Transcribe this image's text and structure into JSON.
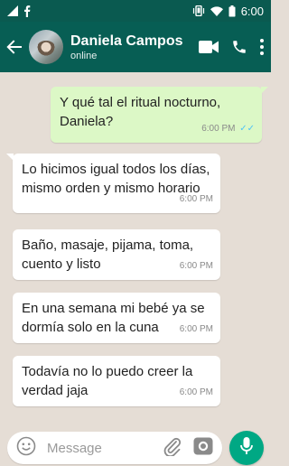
{
  "status_bar": {
    "time": "6:00",
    "icons": [
      "signal-icon",
      "facebook-icon",
      "vibrate-icon",
      "wifi-icon",
      "battery-icon"
    ]
  },
  "header": {
    "contact_name": "Daniela Campos",
    "contact_status": "online",
    "icons": [
      "back-arrow-icon",
      "video-call-icon",
      "phone-icon",
      "more-options-icon"
    ]
  },
  "messages": [
    {
      "direction": "out",
      "text": "Y qué tal el ritual nocturno, Daniela?",
      "time": "6:00 PM",
      "read": true
    },
    {
      "direction": "in",
      "text": "Lo hicimos igual todos los días, mismo orden y mismo horario",
      "time": "6:00 PM"
    },
    {
      "direction": "in",
      "text": "Baño, masaje, pijama, toma, cuento y listo",
      "time": "6:00 PM"
    },
    {
      "direction": "in",
      "text": "En una semana mi bebé ya se dormía solo en la cuna",
      "time": "6:00 PM"
    },
    {
      "direction": "in",
      "text": "Todavía no lo puedo creer la verdad jaja",
      "time": "6:00 PM"
    }
  ],
  "composer": {
    "placeholder": "Message",
    "icons": [
      "emoji-icon",
      "attach-icon",
      "camera-icon",
      "mic-icon"
    ]
  },
  "colors": {
    "header": "#075e54",
    "status_bar": "#0a5a50",
    "outgoing_bubble": "#dcf8c6",
    "incoming_bubble": "#ffffff",
    "read_ticks": "#4fc3f7",
    "mic_button": "#00a884",
    "chat_background": "#e5ddd5"
  }
}
